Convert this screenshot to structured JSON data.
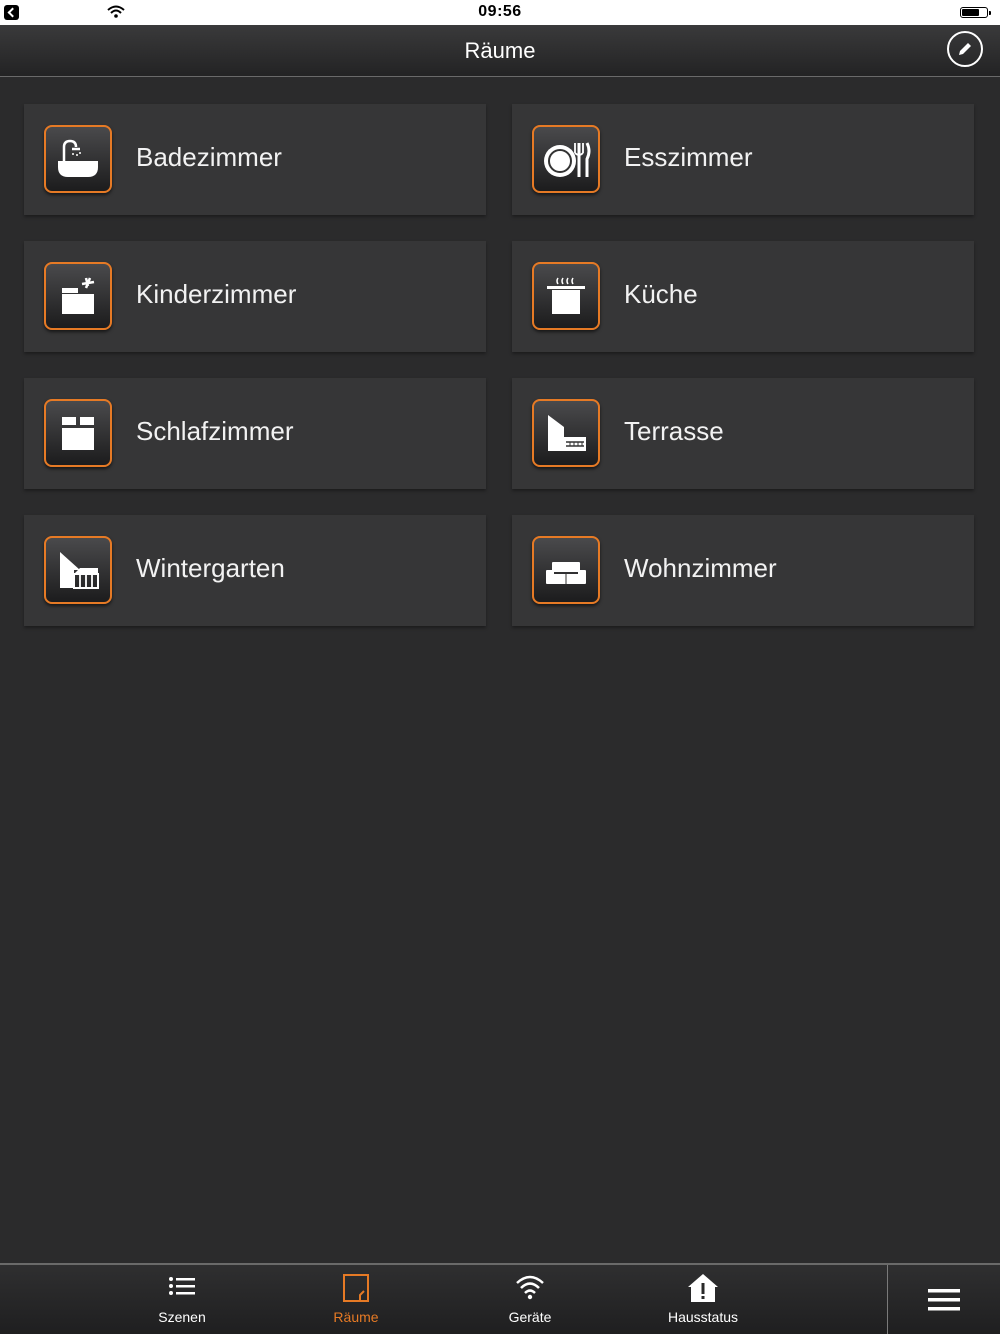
{
  "status_bar": {
    "time": "09:56"
  },
  "header": {
    "title": "Räume"
  },
  "rooms": [
    {
      "label": "Badezimmer",
      "icon": "bathtub-icon"
    },
    {
      "label": "Esszimmer",
      "icon": "plate-cutlery-icon"
    },
    {
      "label": "Kinderzimmer",
      "icon": "toybox-icon"
    },
    {
      "label": "Küche",
      "icon": "cooking-pot-icon"
    },
    {
      "label": "Schlafzimmer",
      "icon": "bed-icon"
    },
    {
      "label": "Terrasse",
      "icon": "terrace-icon"
    },
    {
      "label": "Wintergarten",
      "icon": "wintergarden-icon"
    },
    {
      "label": "Wohnzimmer",
      "icon": "sofa-icon"
    }
  ],
  "tabs": [
    {
      "label": "Szenen",
      "icon": "list-icon"
    },
    {
      "label": "Räume",
      "icon": "room-icon",
      "active": true
    },
    {
      "label": "Geräte",
      "icon": "wifi-icon"
    },
    {
      "label": "Hausstatus",
      "icon": "warning-house-icon"
    }
  ],
  "colors": {
    "accent": "#e67a25",
    "background": "#2b2b2c",
    "card": "#363637"
  }
}
